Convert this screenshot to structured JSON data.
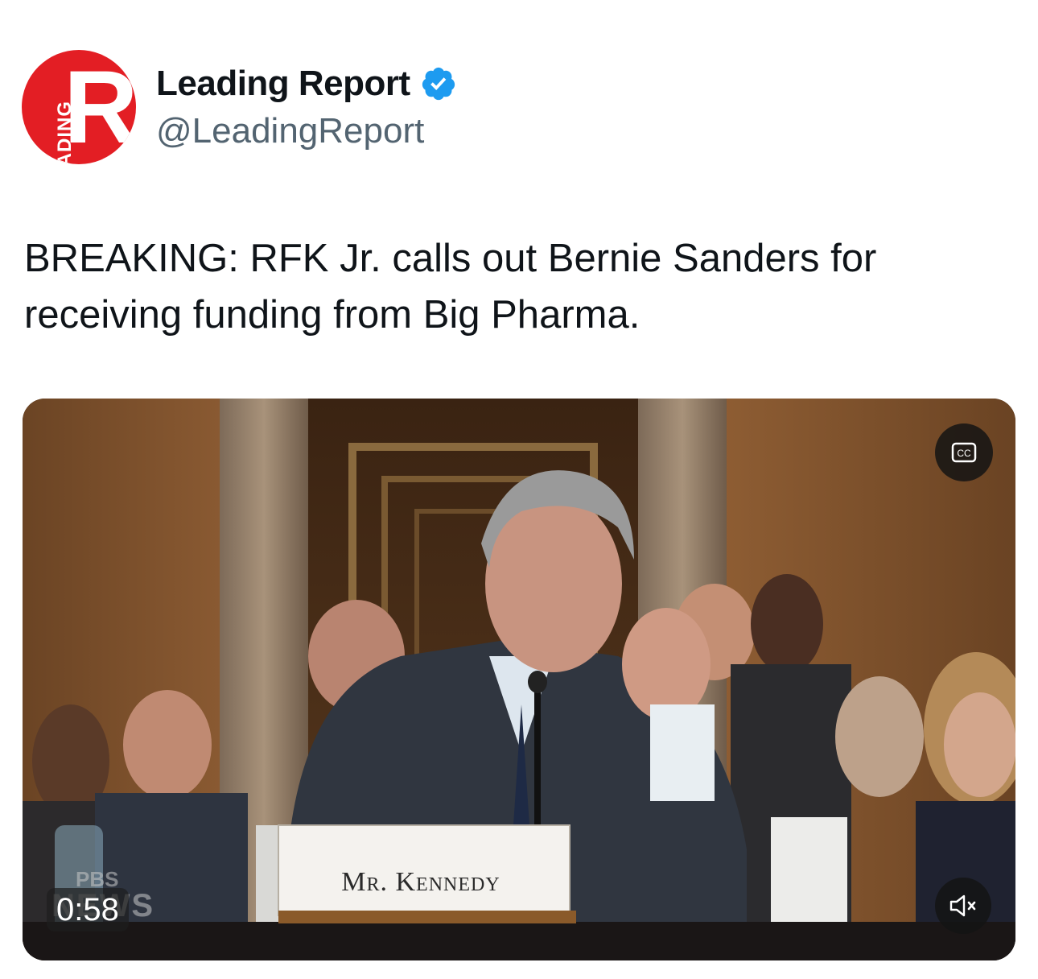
{
  "author": {
    "avatar_letter": "R",
    "avatar_word": "LEADING",
    "display_name": "Leading Report",
    "handle": "@LeadingReport",
    "verified": true
  },
  "tweet": {
    "text": "BREAKING: RFK Jr. calls out Bernie Sanders for receiving funding from Big Pharma."
  },
  "video": {
    "duration": "0:58",
    "nameplate": "Mr. Kennedy",
    "watermark_top": "PBS",
    "watermark_bottom": "NEWS",
    "cc_label": "CC",
    "cc_icon": "closed-captions-icon",
    "mute_icon": "muted-speaker-icon"
  },
  "colors": {
    "text": "#0f1419",
    "secondary_text": "#536471",
    "verified_blue": "#1d9bf0",
    "brand_red": "#e31e24"
  }
}
